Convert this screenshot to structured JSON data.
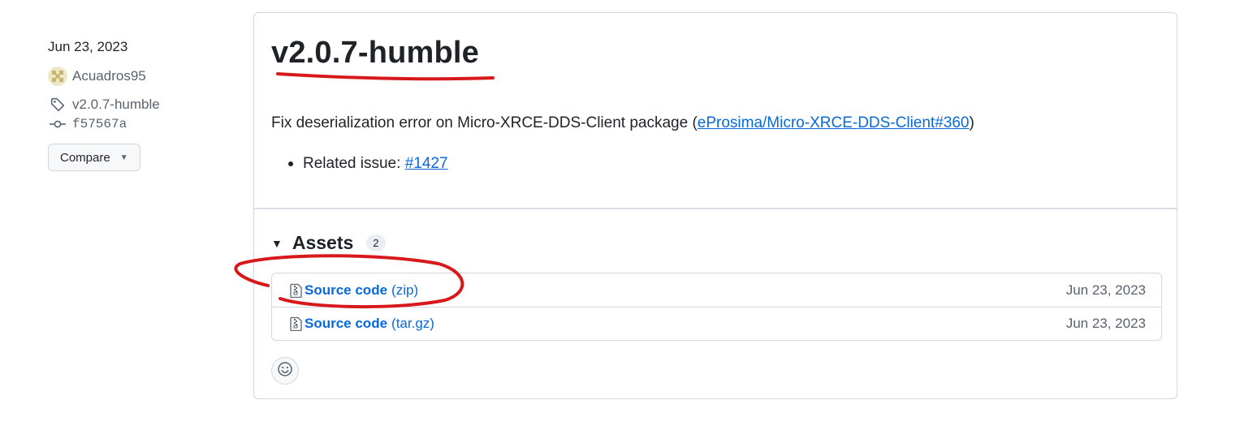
{
  "sidebar": {
    "date": "Jun 23, 2023",
    "author": "Acuadros95",
    "tag": "v2.0.7-humble",
    "commit": "f57567a",
    "compare_label": "Compare"
  },
  "release": {
    "title": "v2.0.7-humble",
    "description_prefix": "Fix deserialization error on Micro-XRCE-DDS-Client package (",
    "description_link": "eProsima/Micro-XRCE-DDS-Client#360",
    "description_suffix": ")",
    "bullet_label": "Related issue: ",
    "bullet_link": "#1427"
  },
  "assets": {
    "title": "Assets",
    "count": "2",
    "items": [
      {
        "name": "Source code",
        "ext": "(zip)",
        "date": "Jun 23, 2023"
      },
      {
        "name": "Source code",
        "ext": "(tar.gz)",
        "date": "Jun 23, 2023"
      }
    ]
  },
  "colors": {
    "link": "#0969da",
    "annotation": "#d7191c",
    "border": "#d0d7de"
  },
  "icons": [
    "tag-icon",
    "commit-icon",
    "file-zip-icon",
    "smiley-icon",
    "triangle-down-icon"
  ]
}
